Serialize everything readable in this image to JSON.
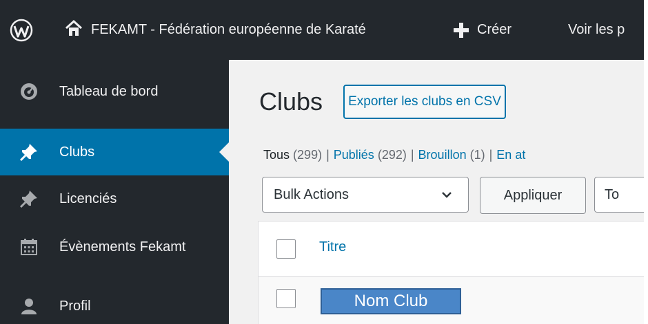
{
  "admin_bar": {
    "wp_logo_icon": "wordpress-icon",
    "site_name": "FEKAMT - Fédération européenne de Karaté",
    "home_icon": "home-icon",
    "new_icon": "plus-icon",
    "new_label": "Créer",
    "view_label": "Voir les p"
  },
  "sidebar": {
    "items": [
      {
        "label": "Tableau de bord",
        "icon": "dashboard-icon"
      },
      {
        "label": "Clubs",
        "icon": "pushpin-icon",
        "active": true
      },
      {
        "label": "Licenciés",
        "icon": "pushpin-icon"
      },
      {
        "label": "Évènements Fekamt",
        "icon": "calendar-icon"
      },
      {
        "label": "Profil",
        "icon": "user-icon"
      }
    ]
  },
  "main": {
    "title": "Clubs",
    "export_button": "Exporter les clubs en CSV",
    "filters": {
      "all_label": "Tous",
      "all_count": "(299)",
      "published_label": "Publiés",
      "published_count": "(292)",
      "draft_label": "Brouillon",
      "draft_count": "(1)",
      "pending_label": "En at",
      "separator": "|"
    },
    "bulk_select": "Bulk Actions",
    "apply_button": "Appliquer",
    "filter_select": "To",
    "table": {
      "title_header": "Titre",
      "rows": [
        {
          "title": "Nom Club"
        }
      ]
    }
  },
  "colors": {
    "admin_dark": "#23282d",
    "accent_blue": "#0073aa",
    "content_bg": "#f1f1f1",
    "highlight_box": "#4a86c8"
  }
}
